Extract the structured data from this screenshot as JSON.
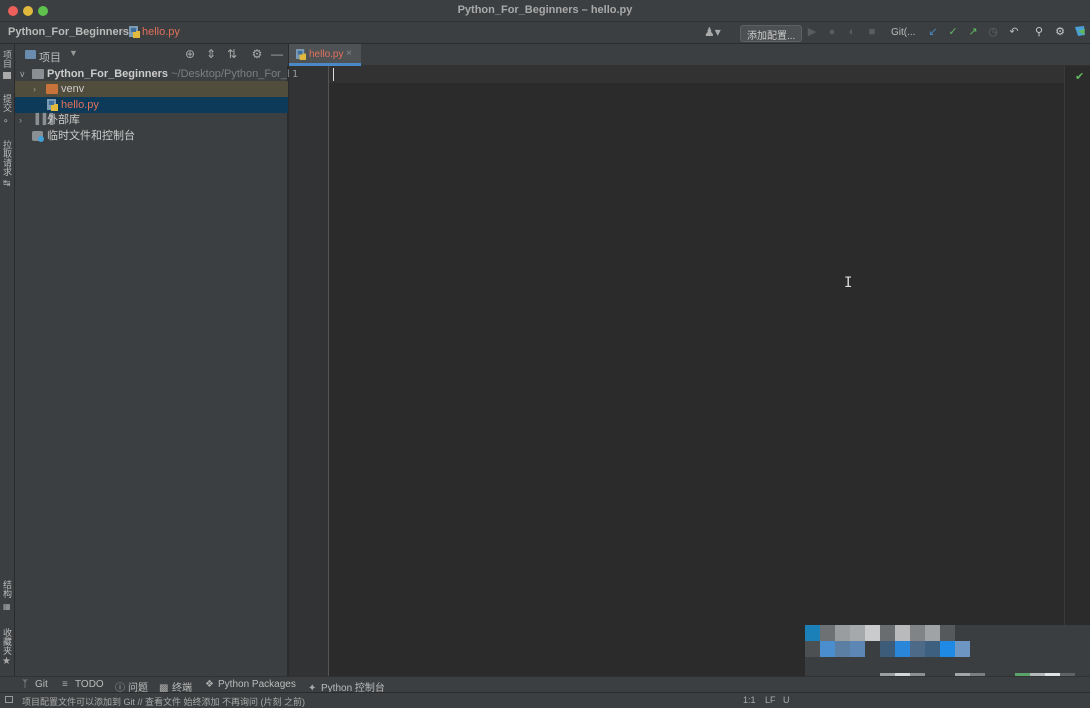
{
  "window": {
    "title": "Python_For_Beginners – hello.py"
  },
  "navbar": {
    "root": "Python_For_Beginners",
    "file": "hello.py",
    "add_config": "添加配置...",
    "git_label": "Git(..."
  },
  "left_tool_tabs": [
    "项目",
    "提交",
    "拉取请求",
    "结构",
    "收藏夹"
  ],
  "project_panel": {
    "title": "项目",
    "tree": {
      "root_name": "Python_For_Beginners",
      "root_path": "~/Desktop/Python_For_Be",
      "venv": "venv",
      "hello": "hello.py",
      "external": "外部库",
      "scratches": "临时文件和控制台"
    }
  },
  "editor": {
    "tab_label": "hello.py",
    "tab_close": "×",
    "line_number": "1"
  },
  "bottom_tools": [
    {
      "icon": "git-branch-icon",
      "label": "Git"
    },
    {
      "icon": "todo-icon",
      "label": "TODO"
    },
    {
      "icon": "problems-icon",
      "label": "问题"
    },
    {
      "icon": "terminal-icon",
      "label": "终端"
    },
    {
      "icon": "packages-icon",
      "label": "Python Packages"
    },
    {
      "icon": "python-console-icon",
      "label": "Python 控制台"
    }
  ],
  "statusbar": {
    "message": "项目配置文件可以添加到 Git // 查看文件   始终添加   不再询问 (片刻 之前)",
    "position": "1:1",
    "line_sep": "LF",
    "encoding": "U"
  },
  "colors": {
    "accent": "#4a88c7",
    "file_modified": "#e0715b",
    "venv_row": "#514d3c",
    "selected_row": "#0d3a58",
    "ok_check": "#5fb95f"
  }
}
